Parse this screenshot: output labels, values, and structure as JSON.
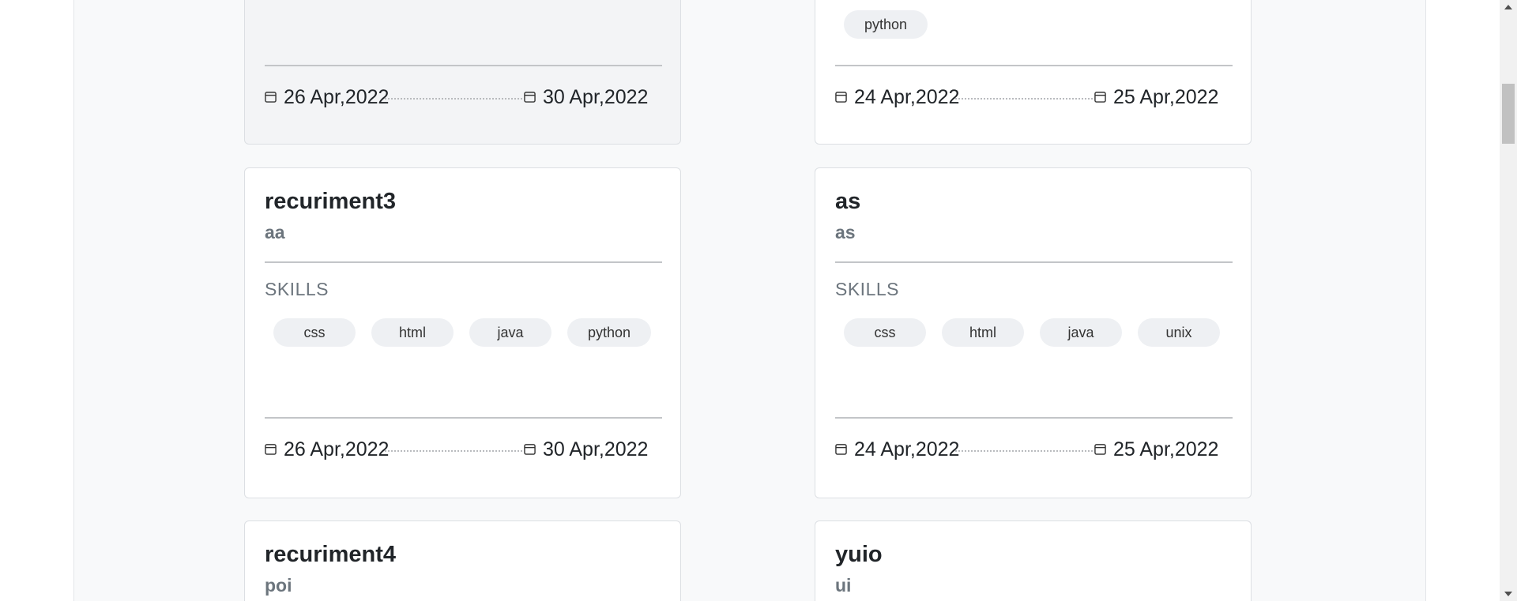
{
  "cards": [
    {
      "title": "",
      "subtitle": "",
      "start_date": "26 Apr,2022",
      "end_date": "30 Apr,2022"
    },
    {
      "title": "",
      "subtitle": "",
      "skills": [
        "python"
      ],
      "start_date": "24 Apr,2022",
      "end_date": "25 Apr,2022"
    },
    {
      "title": "recuriment3",
      "subtitle": "aa",
      "skills_label": "SKILLS",
      "skills": [
        "css",
        "html",
        "java",
        "python"
      ],
      "start_date": "26 Apr,2022",
      "end_date": "30 Apr,2022"
    },
    {
      "title": "as",
      "subtitle": "as",
      "skills_label": "SKILLS",
      "skills": [
        "css",
        "html",
        "java",
        "unix"
      ],
      "start_date": "24 Apr,2022",
      "end_date": "25 Apr,2022"
    },
    {
      "title": "recuriment4",
      "subtitle": "poi"
    },
    {
      "title": "yuio",
      "subtitle": "ui"
    }
  ],
  "icons": {
    "date": "calendar-icon",
    "scroll_up": "triangle-up-icon",
    "scroll_down": "triangle-down-icon"
  },
  "colors": {
    "page_bg": "#f8f9fa",
    "card_bg": "#ffffff",
    "card_muted_bg": "#f3f4f6",
    "chip_bg": "#eef0f3",
    "muted_text": "#6c757d"
  }
}
